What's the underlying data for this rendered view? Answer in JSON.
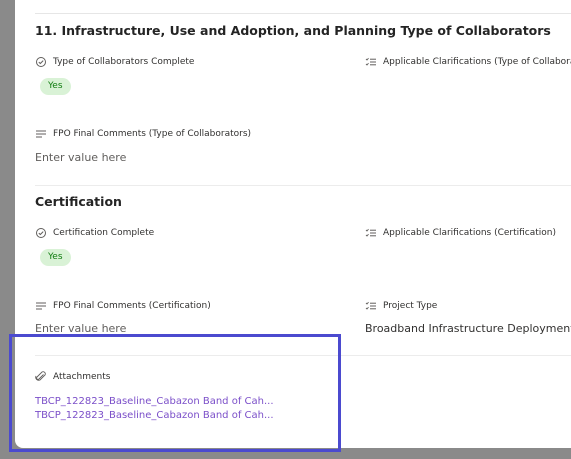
{
  "section1": {
    "title": "11. Infrastructure, Use and Adoption, and Planning Type of Collaborators",
    "complete_label": "Type of Collaborators Complete",
    "complete_value": "Yes",
    "clarifications_label": "Applicable Clarifications (Type of Collabora",
    "comments_label": "FPO Final Comments (Type of Collaborators)",
    "comments_placeholder": "Enter value here"
  },
  "section2": {
    "title": "Certification",
    "complete_label": "Certification Complete",
    "complete_value": "Yes",
    "clarifications_label": "Applicable Clarifications (Certification)",
    "comments_label": "FPO Final Comments (Certification)",
    "comments_placeholder": "Enter value here",
    "project_type_label": "Project Type",
    "project_type_value": "Broadband Infrastructure Deployment"
  },
  "attachments": {
    "label": "Attachments",
    "files": [
      "TBCP_122823_Baseline_Cabazon Band of Cah...",
      "TBCP_122823_Baseline_Cabazon Band of Cah..."
    ]
  },
  "icons": {
    "check": "check-circle-icon",
    "list": "text-list-icon",
    "text": "text-lines-icon",
    "attach": "paperclip-icon"
  },
  "colors": {
    "pill_bg": "#d9f2d6",
    "pill_text": "#107c10",
    "link": "#7b4fc9",
    "highlight": "#4b4acf"
  }
}
